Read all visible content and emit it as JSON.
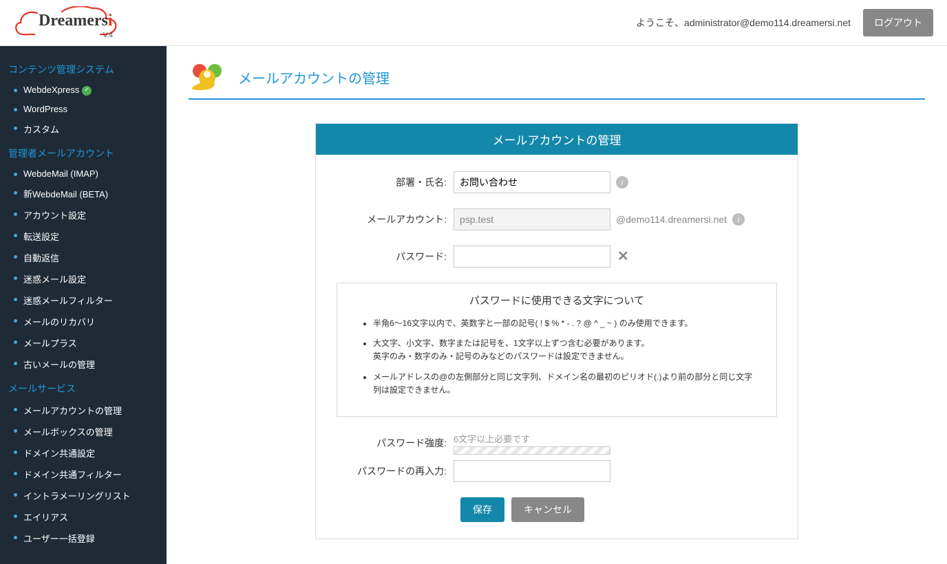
{
  "header": {
    "logo_main": "Dreamers",
    "logo_accent": "i",
    "logo_version": "V.4",
    "welcome": "ようこそ、administrator@demo114.dreamersi.net",
    "logout": "ログアウト"
  },
  "sidebar": {
    "sec1": {
      "heading": "コンテンツ管理システム",
      "i0": "WebdeXpress",
      "i1": "WordPress",
      "i2": "カスタム"
    },
    "sec2": {
      "heading": "管理者メールアカウント",
      "i0": "WebdeMail (IMAP)",
      "i1": "新WebdeMail (BETA)",
      "i2": "アカウント設定",
      "i3": "転送設定",
      "i4": "自動返信",
      "i5": "迷惑メール設定",
      "i6": "迷惑メールフィルター",
      "i7": "メールのリカバリ",
      "i8": "メールプラス",
      "i9": "古いメールの管理"
    },
    "sec3": {
      "heading": "メールサービス",
      "i0": "メールアカウントの管理",
      "i1": "メールボックスの管理",
      "i2": "ドメイン共通設定",
      "i3": "ドメイン共通フィルター",
      "i4": "イントラメーリングリスト",
      "i5": "エイリアス",
      "i6": "ユーザー一括登録"
    }
  },
  "page": {
    "title": "メールアカウントの管理"
  },
  "panel": {
    "header": "メールアカウントの管理",
    "labels": {
      "department": "部署・氏名:",
      "account": "メールアカウント:",
      "password": "パスワード:",
      "strength": "パスワード強度:",
      "reenter": "パスワードの再入力:"
    },
    "values": {
      "department": "お問い合わせ",
      "account": "psp.test",
      "domain_suffix": "@demo114.dreamersi.net",
      "password": "",
      "reenter": "",
      "strength_msg": "6文字以上必要です"
    },
    "rules": {
      "title": "パスワードに使用できる文字について",
      "r1": "半角6〜16文字以内で、英数字と一部の記号( ! $ % * - . ? @ ^ _ ~ ) のみ使用できます。",
      "r2a": "大文字、小文字、数字または記号を、1文字以上ずつ含む必要があります。",
      "r2b": "英字のみ・数字のみ・記号のみなどのパスワードは設定できません。",
      "r3": "メールアドレスの@の左側部分と同じ文字列、ドメイン名の最初のピリオド(.)より前の部分と同じ文字列は設定できません。"
    },
    "buttons": {
      "save": "保存",
      "cancel": "キャンセル"
    }
  }
}
